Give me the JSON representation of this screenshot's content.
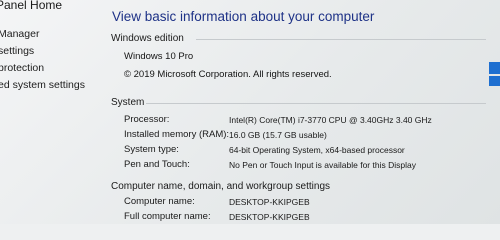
{
  "nav": {
    "crumb": "Panel Home",
    "items": [
      {
        "label": "Manager"
      },
      {
        "label": "settings"
      },
      {
        "label": "protection"
      },
      {
        "label": "ed system settings"
      }
    ]
  },
  "title": "View basic information about your computer",
  "windows_edition": {
    "heading": "Windows edition",
    "edition": "Windows 10 Pro",
    "copyright": "© 2019 Microsoft Corporation. All rights reserved."
  },
  "system": {
    "heading": "System",
    "rows": [
      {
        "label": "Processor:",
        "value": "Intel(R) Core(TM) i7-3770 CPU @ 3.40GHz   3.40 GHz"
      },
      {
        "label": "Installed memory (RAM):",
        "value": "16.0 GB (15.7 GB usable)"
      },
      {
        "label": "System type:",
        "value": "64-bit Operating System, x64-based processor"
      },
      {
        "label": "Pen and Touch:",
        "value": "No Pen or Touch Input is available for this Display"
      }
    ]
  },
  "computer_name": {
    "heading": "Computer name, domain, and workgroup settings",
    "rows": [
      {
        "label": "Computer name:",
        "value": "DESKTOP-KKIPGEB"
      },
      {
        "label": "Full computer name:",
        "value": "DESKTOP-KKIPGEB"
      }
    ]
  },
  "colors": {
    "title": "#1e3287",
    "logo": "#1e6fd0"
  }
}
